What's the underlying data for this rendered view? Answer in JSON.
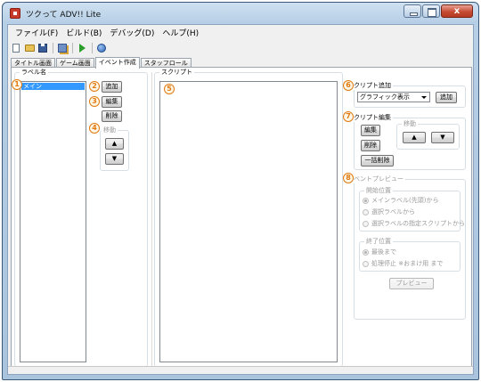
{
  "window": {
    "title": "ツクって ADV!! Lite",
    "close_label": "x"
  },
  "menu": [
    "ファイル(F)",
    "ビルド(B)",
    "デバッグ(D)",
    "ヘルプ(H)"
  ],
  "toolbar": [
    "new-file-icon",
    "open-folder-icon",
    "save-icon",
    "copy-icon",
    "run-icon",
    "help-icon"
  ],
  "tabs": [
    "タイトル画面",
    "ゲーム画面",
    "イベント作成",
    "スタッフロール"
  ],
  "active_tab": "イベント作成",
  "labels_panel": {
    "title": "ラベル名",
    "items": [
      "メイン"
    ],
    "add_button": "追加",
    "edit_button": "編集",
    "delete_button": "削除",
    "move_group": "移動",
    "up_arrow": "▲",
    "down_arrow": "▼"
  },
  "script_panel": {
    "title": "スクリプト"
  },
  "script_add": {
    "title": "スクリプト追加",
    "selected": "グラフィック表示",
    "add_button": "追加"
  },
  "script_edit": {
    "title": "スクリプト編集",
    "edit_button": "編集",
    "delete_button": "削除",
    "bulk_delete_button": "一括削除",
    "move_group": "移動",
    "up_arrow": "▲",
    "down_arrow": "▼"
  },
  "event_preview": {
    "title": "イベントプレビュー",
    "start_group": "開始位置",
    "start_options": [
      "メインラベル(先頭)から",
      "選択ラベルから",
      "選択ラベルの指定スクリプトから"
    ],
    "end_group": "終了位置",
    "end_options": [
      "最後まで",
      "処理停止 ※おまけ用 まで"
    ],
    "preview_button": "プレビュー"
  },
  "annotations": [
    "1",
    "2",
    "3",
    "4",
    "5",
    "6",
    "7",
    "8"
  ],
  "colors": {
    "accent_selection": "#3399ff",
    "annotation": "#e07a10",
    "titlebar": "#b7cfe6"
  }
}
